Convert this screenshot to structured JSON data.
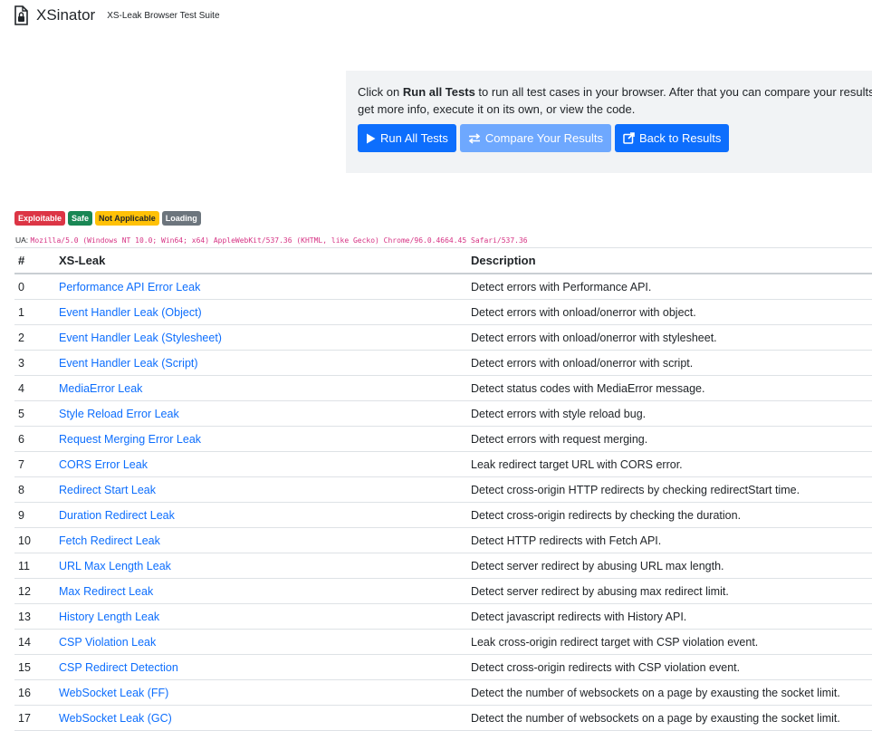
{
  "header": {
    "icon": "shield-lock-icon",
    "title": "XSinator",
    "subtitle": "XS-Leak Browser Test Suite"
  },
  "intro": {
    "text_before": "Click on ",
    "text_bold": "Run all Tests",
    "text_after_line1": " to run all test cases in your browser. After that you can compare your results",
    "text_line2": "get more info, execute it on its own, or view the code.",
    "buttons": {
      "run_all": "Run All Tests",
      "compare": "Compare Your Results",
      "back": "Back to Results"
    }
  },
  "legend": {
    "exploitable": "Exploitable",
    "safe": "Safe",
    "not_applicable": "Not Applicable",
    "loading": "Loading"
  },
  "ua": {
    "label": "UA:",
    "value": "Mozilla/5.0 (Windows NT 10.0; Win64; x64) AppleWebKit/537.36 (KHTML, like Gecko) Chrome/96.0.4664.45 Safari/537.36"
  },
  "table": {
    "headers": {
      "num": "#",
      "name": "XS-Leak",
      "desc": "Description"
    },
    "rows": [
      {
        "num": "0",
        "name": "Performance API Error Leak",
        "desc": "Detect errors with Performance API."
      },
      {
        "num": "1",
        "name": "Event Handler Leak (Object)",
        "desc": "Detect errors with onload/onerror with object."
      },
      {
        "num": "2",
        "name": "Event Handler Leak (Stylesheet)",
        "desc": "Detect errors with onload/onerror with stylesheet."
      },
      {
        "num": "3",
        "name": "Event Handler Leak (Script)",
        "desc": "Detect errors with onload/onerror with script."
      },
      {
        "num": "4",
        "name": "MediaError Leak",
        "desc": "Detect status codes with MediaError message."
      },
      {
        "num": "5",
        "name": "Style Reload Error Leak",
        "desc": "Detect errors with style reload bug."
      },
      {
        "num": "6",
        "name": "Request Merging Error Leak",
        "desc": "Detect errors with request merging."
      },
      {
        "num": "7",
        "name": "CORS Error Leak",
        "desc": "Leak redirect target URL with CORS error."
      },
      {
        "num": "8",
        "name": "Redirect Start Leak",
        "desc": "Detect cross-origin HTTP redirects by checking redirectStart time."
      },
      {
        "num": "9",
        "name": "Duration Redirect Leak",
        "desc": "Detect cross-origin redirects by checking the duration."
      },
      {
        "num": "10",
        "name": "Fetch Redirect Leak",
        "desc": "Detect HTTP redirects with Fetch API."
      },
      {
        "num": "11",
        "name": "URL Max Length Leak",
        "desc": "Detect server redirect by abusing URL max length."
      },
      {
        "num": "12",
        "name": "Max Redirect Leak",
        "desc": "Detect server redirect by abusing max redirect limit."
      },
      {
        "num": "13",
        "name": "History Length Leak",
        "desc": "Detect javascript redirects with History API."
      },
      {
        "num": "14",
        "name": "CSP Violation Leak",
        "desc": "Leak cross-origin redirect target with CSP violation event."
      },
      {
        "num": "15",
        "name": "CSP Redirect Detection",
        "desc": "Detect cross-origin redirects with CSP violation event."
      },
      {
        "num": "16",
        "name": "WebSocket Leak (FF)",
        "desc": "Detect the number of websockets on a page by exausting the socket limit."
      },
      {
        "num": "17",
        "name": "WebSocket Leak (GC)",
        "desc": "Detect the number of websockets on a page by exausting the socket limit."
      }
    ]
  },
  "colors": {
    "link": "#0d6efd",
    "exploitable": "#dc3545",
    "safe": "#198754",
    "not_applicable": "#ffc107",
    "loading": "#6c757d",
    "ua": "#d63384"
  }
}
